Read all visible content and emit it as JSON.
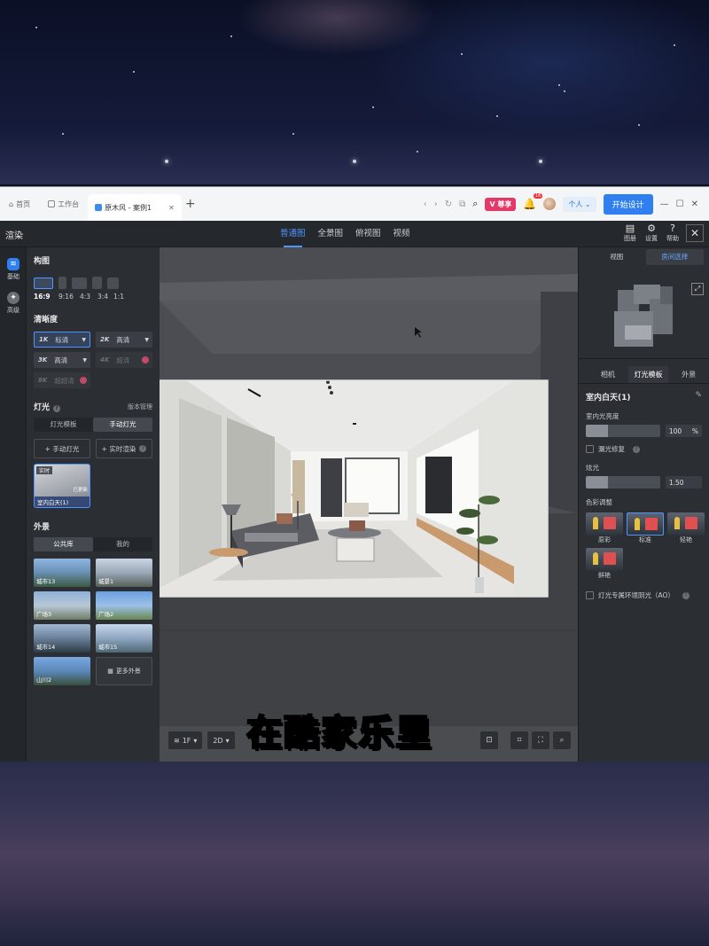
{
  "browser": {
    "tabs": [
      {
        "label": "首页"
      },
      {
        "label": "工作台"
      },
      {
        "label": "原木风 - 案例1"
      }
    ],
    "vip_label": "V 尊享",
    "notif_count": "16",
    "persona_label": "个人",
    "start_button": "开始设计"
  },
  "toolbar": {
    "title": "渲染",
    "view_tabs": [
      "普通图",
      "全景图",
      "俯视图",
      "视频"
    ],
    "active_view": "普通图",
    "tools": [
      {
        "label": "图册",
        "icon": "gallery-icon"
      },
      {
        "label": "设置",
        "icon": "gear-icon"
      },
      {
        "label": "帮助",
        "icon": "help-icon"
      }
    ]
  },
  "rail": {
    "items": [
      {
        "label": "基础",
        "icon": "basic-settings-icon"
      },
      {
        "label": "高级",
        "icon": "advanced-settings-icon"
      }
    ]
  },
  "left": {
    "composition": {
      "title": "构图",
      "ratios": [
        "16:9",
        "9:16",
        "4:3",
        "3:4",
        "1:1"
      ],
      "selected": "16:9"
    },
    "quality": {
      "title": "清晰度",
      "options": [
        {
          "res": "1K",
          "label": "标清"
        },
        {
          "res": "2K",
          "label": "高清"
        },
        {
          "res": "3K",
          "label": "高清"
        },
        {
          "res": "4K",
          "label": "超清"
        },
        {
          "res": "8K",
          "label": "超超清"
        }
      ]
    },
    "lighting": {
      "title": "灯光",
      "manage": "版本管理",
      "modes": [
        "灯光模板",
        "手动灯光"
      ],
      "active_mode": "手动灯光",
      "buttons": [
        "+ 手动灯光",
        "+ 实时渲染"
      ],
      "preset": {
        "tag": "实时",
        "note": "已更新",
        "caption": "室内白天(1)"
      }
    },
    "environment": {
      "title": "外景",
      "tabs": [
        "公共库",
        "我的"
      ],
      "active_tab": "公共库",
      "items": [
        "城市13",
        "城景1",
        "广场3",
        "广场2",
        "城市14",
        "城市15",
        "山川2"
      ],
      "more": "更多外景"
    }
  },
  "viewport": {
    "floor": "1F",
    "mode": "2D",
    "subtitle": "在酷家乐里"
  },
  "right": {
    "top_tabs": [
      "视图",
      "房间选择"
    ],
    "active_top_tab": "房间选择",
    "tabs": [
      "相机",
      "灯光模板",
      "外景"
    ],
    "active_tab": "灯光模板",
    "preset_title": "室内白天(1)",
    "brightness": {
      "label": "室内光亮度",
      "value": "100",
      "unit": "%",
      "fraction": 0.3
    },
    "inherit_label": "漏光修复",
    "glare": {
      "label": "炫光",
      "value": "1.50",
      "fraction": 0.3
    },
    "color_section": "色彩调整",
    "styles": [
      {
        "label": "原彩",
        "selected": false
      },
      {
        "label": "标准",
        "selected": true
      },
      {
        "label": "轻艳",
        "selected": false
      },
      {
        "label": "鲜艳",
        "selected": false
      }
    ],
    "ao_label": "灯光专属环境阴光（AO）"
  }
}
